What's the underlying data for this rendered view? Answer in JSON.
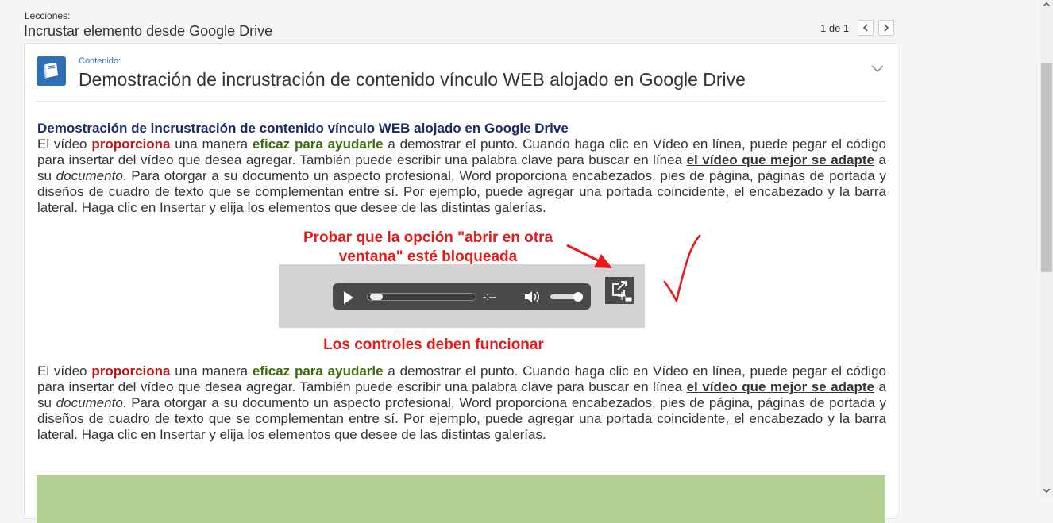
{
  "header": {
    "lessons_label": "Lecciones:",
    "lesson_title": "Incrustar elemento desde Google Drive",
    "pager": {
      "text": "1 de 1"
    }
  },
  "card": {
    "content_label": "Contenido:",
    "title": "Demostración de incrustración de contenido vínculo WEB alojado en Google Drive",
    "accent_color": "#2f6fb6",
    "icons": [
      "book-icon",
      "chevron-down-icon"
    ]
  },
  "paragraph": {
    "heading": "Demostración de incrustración de contenido vínculo WEB alojado en Google Drive",
    "s1": "El vídeo ",
    "s2": "proporciona",
    "s3": " una manera ",
    "s4": "eficaz para ayudarle",
    "s5": " a demostrar el punto. Cuando haga clic en Vídeo en línea, puede pegar el código para insertar del vídeo que desea agregar. También puede escribir una palabra clave para buscar en línea ",
    "s6": "el vídeo que mejor se adapte",
    "s7": " a su ",
    "s8": "documento",
    "s9": ". Para otorgar a su documento un aspecto profesional, Word proporciona encabezados, pies de página, páginas de portada y diseños de cuadro de texto que se complementan entre sí. Por ejemplo, puede agregar una portada coincidente, el encabezado y la barra lateral. Haga clic en Insertar y elija los elementos que desee de las distintas galerías."
  },
  "annotations": {
    "top_line1": "Probar que la opción \"abrir en otra",
    "top_line2": "ventana\" esté bloqueada",
    "bottom": "Los controles deben funcionar",
    "color": "#e31b1b"
  },
  "player": {
    "time": "-:--",
    "progress": 0.0,
    "volume": 0.85,
    "icons": [
      "play-icon",
      "volume-icon",
      "open-new-window-icon"
    ]
  },
  "colors": {
    "heading": "#1a2a6c",
    "red_word": "#c0171b",
    "green_word": "#3d6b0d",
    "green_bar": "#b1cf93"
  }
}
